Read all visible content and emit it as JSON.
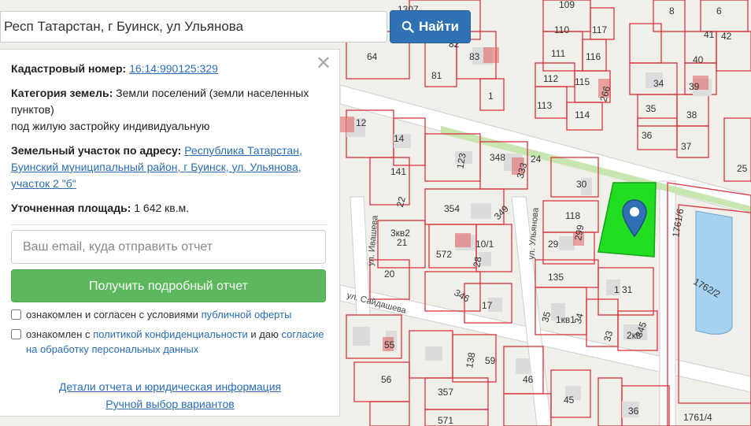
{
  "search": {
    "value": "Респ Татарстан, г Буинск, ул Ульянова",
    "button_label": "Найти"
  },
  "panel": {
    "cadastral_label": "Кадастровый номер:",
    "cadastral_value": "16:14:990125:329",
    "category_label": "Категория земель:",
    "category_value_1": "Земли поселений (земли населенных пунктов)",
    "category_value_2": "под жилую застройку индивидуальную",
    "address_label": "Земельный участок по адресу:",
    "address_value": "Республика Татарстан, Буинский муниципальный район, г Буинск, ул. Ульянова, участок 2 \"б\"",
    "area_label": "Уточненная площадь:",
    "area_value": "1 642 кв.м.",
    "email_placeholder": "Ваш email, куда отправить отчет",
    "submit_label": "Получить подробный отчет",
    "consent1_text": "ознакомлен и согласен с условиями",
    "consent1_link": "публичной оферты",
    "consent2_text_a": "ознакомлен с",
    "consent2_link_a": "политикой конфиденциальности",
    "consent2_text_b": "и даю",
    "consent2_link_b": "согласие на обработку персональных данных",
    "details_link": "Детали отчета и юридическая информация",
    "manual_link": "Ручной выбор вариантов"
  },
  "map_labels": {
    "street_1": "ул. Ивашева",
    "street_2": "ул. Ульянова",
    "street_3": "ул. Сайдашева",
    "lot_1": "1761/6",
    "lot_2": "1762/2",
    "lot_3": "1761/4",
    "n1307": "1307",
    "n109": "109",
    "n8": "8",
    "n6": "6",
    "n64": "64",
    "n82": "82",
    "n83": "83",
    "n110": "110",
    "n117": "117",
    "n111": "111",
    "n116": "116",
    "n112": "112",
    "n115": "115",
    "n113": "113",
    "n114": "114",
    "n266": "266",
    "n81": "81",
    "n1": "1",
    "n34": "34",
    "n35": "35",
    "n36": "36",
    "n37": "37",
    "n38": "38",
    "n39": "39",
    "n40": "40",
    "n41": "41",
    "n42": "42",
    "n25": "25",
    "n12": "12",
    "n14": "14",
    "n141": "141",
    "n123": "123",
    "n348": "348",
    "n333": "333",
    "n24": "24",
    "n30": "30",
    "n118": "118",
    "n299": "299",
    "n29": "29",
    "n354": "354",
    "n349": "349",
    "n572": "572",
    "n10_1": "10/1",
    "n28": "28",
    "n22": "22",
    "n21": "21",
    "n20": "20",
    "n135": "135",
    "n31": "31",
    "n346": "346",
    "n17": "17",
    "n345": "345",
    "n33": "33",
    "n55": "55",
    "n56": "56",
    "n138": "138",
    "n59": "59",
    "n46": "46",
    "n45": "45",
    "n357": "357",
    "n571": "571",
    "n36b": "36",
    "n3kv2": "3кв2",
    "n1kv1": "1кв1",
    "n2kv": "2кв"
  },
  "colors": {
    "parcel_line": "#d9343f",
    "selected_parcel": "#22dd22",
    "water": "#a6d2ef",
    "road": "#ffffff",
    "building": "#d9d9d9",
    "marker": "#2f71b5",
    "button_blue": "#2f71b5",
    "button_green": "#5cb85c"
  },
  "icons": {
    "search": "search-icon",
    "close": "close-icon",
    "marker": "map-marker-icon"
  }
}
